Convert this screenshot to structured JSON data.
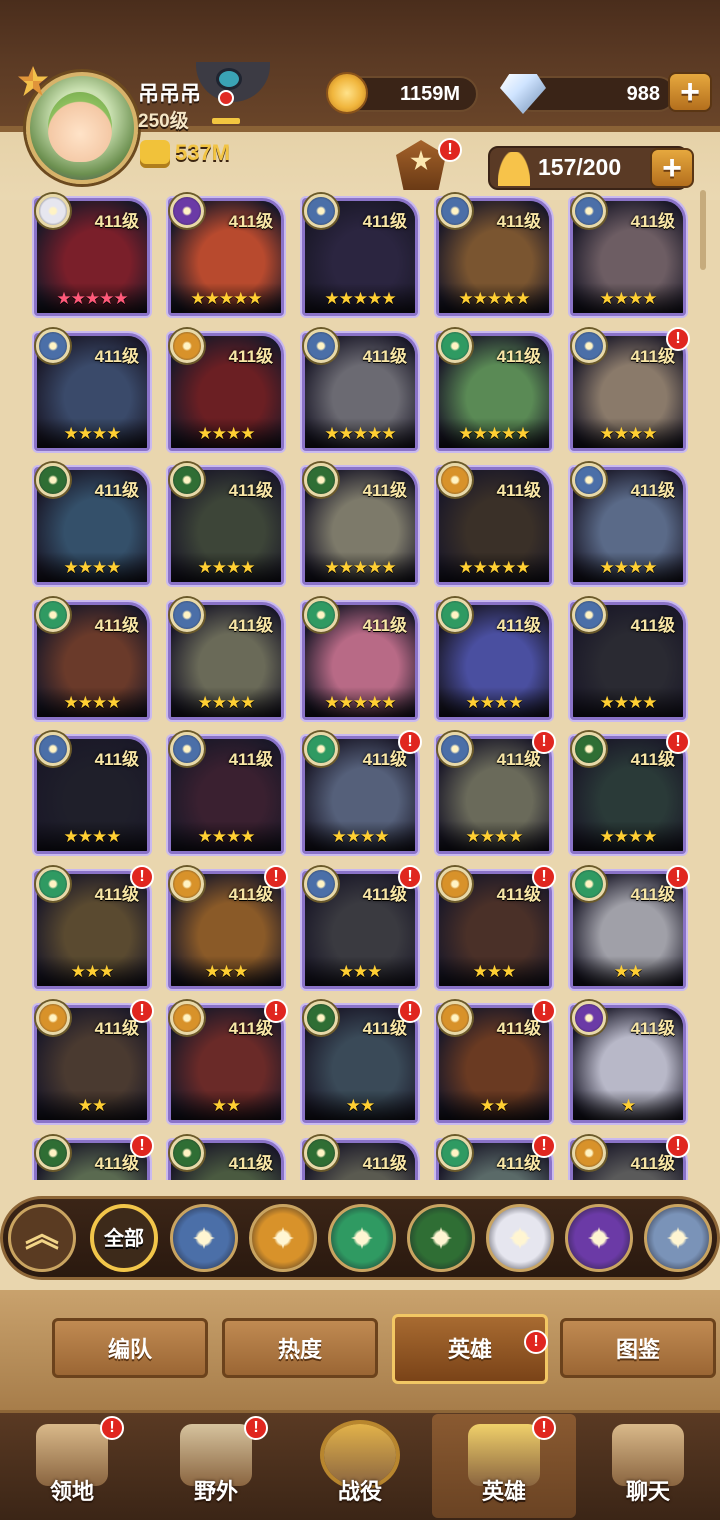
{
  "player": {
    "name": "吊吊吊",
    "level": "250级",
    "power": "537M"
  },
  "resources": {
    "gold": "1159M",
    "gems": "988",
    "roster": "157/200"
  },
  "heroes": [
    {
      "level": "411级",
      "stars": "★★★★★",
      "star_color": "#ff5a7a",
      "faction": "celestial",
      "art": "#7a1f2a"
    },
    {
      "level": "411级",
      "stars": "★★★★★",
      "star_color": "#ffcf33",
      "faction": "hypogean",
      "art": "#b84a2e"
    },
    {
      "level": "411级",
      "stars": "★★★★★",
      "star_color": "#ffcf33",
      "faction": "lightbearer",
      "art": "#2b2540"
    },
    {
      "level": "411级",
      "stars": "★★★★★",
      "star_color": "#ffcf33",
      "faction": "lightbearer",
      "art": "#7a5530"
    },
    {
      "level": "411级",
      "stars": "★★★★",
      "star_color": "#ffcf33",
      "faction": "lightbearer",
      "art": "#6d5d63"
    },
    {
      "level": "411级",
      "stars": "★★★★",
      "star_color": "#ffcf33",
      "faction": "lightbearer",
      "art": "#3a4a6a"
    },
    {
      "level": "411级",
      "stars": "★★★★",
      "star_color": "#ffcf33",
      "faction": "mauler",
      "art": "#6b1f23"
    },
    {
      "level": "411级",
      "stars": "★★★★★",
      "star_color": "#ffcf33",
      "faction": "lightbearer",
      "art": "#6b6a72"
    },
    {
      "level": "411级",
      "stars": "★★★★★",
      "star_color": "#ffcf33",
      "faction": "wilder",
      "art": "#5a8a55"
    },
    {
      "level": "411级",
      "stars": "★★★★",
      "star_color": "#ffcf33",
      "faction": "lightbearer",
      "art": "#8a7a6a",
      "alert": true
    },
    {
      "level": "411级",
      "stars": "★★★★",
      "star_color": "#ffcf33",
      "faction": "graveborn",
      "art": "#34506a"
    },
    {
      "level": "411级",
      "stars": "★★★★",
      "star_color": "#ffcf33",
      "faction": "graveborn",
      "art": "#3d4538"
    },
    {
      "level": "411级",
      "stars": "★★★★★",
      "star_color": "#ffcf33",
      "faction": "graveborn",
      "art": "#7d7a6a"
    },
    {
      "level": "411级",
      "stars": "★★★★★",
      "star_color": "#ffcf33",
      "faction": "mauler",
      "art": "#3a3028"
    },
    {
      "level": "411级",
      "stars": "★★★★",
      "star_color": "#ffcf33",
      "faction": "lightbearer",
      "art": "#5a6a88"
    },
    {
      "level": "411级",
      "stars": "★★★★",
      "star_color": "#ffcf33",
      "faction": "wilder",
      "art": "#6a3a2a"
    },
    {
      "level": "411级",
      "stars": "★★★★",
      "star_color": "#ffcf33",
      "faction": "lightbearer",
      "art": "#6a6a58"
    },
    {
      "level": "411级",
      "stars": "★★★★★",
      "star_color": "#ffcf33",
      "faction": "wilder",
      "art": "#b86a86"
    },
    {
      "level": "411级",
      "stars": "★★★★",
      "star_color": "#ffcf33",
      "faction": "wilder",
      "art": "#4a4fa0"
    },
    {
      "level": "411级",
      "stars": "★★★★",
      "star_color": "#ffcf33",
      "faction": "lightbearer",
      "art": "#2a2a32"
    },
    {
      "level": "411级",
      "stars": "★★★★",
      "star_color": "#ffcf33",
      "faction": "lightbearer",
      "art": "#1f1f2a"
    },
    {
      "level": "411级",
      "stars": "★★★★",
      "star_color": "#ffcf33",
      "faction": "lightbearer",
      "art": "#3a2030"
    },
    {
      "level": "411级",
      "stars": "★★★★",
      "star_color": "#ffcf33",
      "faction": "wilder",
      "art": "#55607a",
      "alert": true
    },
    {
      "level": "411级",
      "stars": "★★★★",
      "star_color": "#ffcf33",
      "faction": "lightbearer",
      "art": "#6a6a5a",
      "alert": true
    },
    {
      "level": "411级",
      "stars": "★★★★",
      "star_color": "#ffcf33",
      "faction": "graveborn",
      "art": "#2a3a38",
      "alert": true
    },
    {
      "level": "411级",
      "stars": "★★★",
      "star_color": "#ffcf33",
      "faction": "wilder",
      "art": "#5a4a30",
      "alert": true
    },
    {
      "level": "411级",
      "stars": "★★★",
      "star_color": "#ffcf33",
      "faction": "mauler",
      "art": "#8a5a28",
      "alert": true
    },
    {
      "level": "411级",
      "stars": "★★★",
      "star_color": "#ffcf33",
      "faction": "lightbearer",
      "art": "#3a3a40",
      "alert": true
    },
    {
      "level": "411级",
      "stars": "★★★",
      "star_color": "#ffcf33",
      "faction": "mauler",
      "art": "#4a3028",
      "alert": true
    },
    {
      "level": "411级",
      "stars": "★★",
      "star_color": "#ffcf33",
      "faction": "wilder",
      "art": "#a0a0a8",
      "alert": true
    },
    {
      "level": "411级",
      "stars": "★★",
      "star_color": "#ffcf33",
      "faction": "mauler",
      "art": "#4a3a30",
      "alert": true
    },
    {
      "level": "411级",
      "stars": "★★",
      "star_color": "#ffcf33",
      "faction": "mauler",
      "art": "#6a2a28",
      "alert": true
    },
    {
      "level": "411级",
      "stars": "★★",
      "star_color": "#ffcf33",
      "faction": "graveborn",
      "art": "#3a4a58",
      "alert": true
    },
    {
      "level": "411级",
      "stars": "★★",
      "star_color": "#ffcf33",
      "faction": "mauler",
      "art": "#6a3a22",
      "alert": true
    },
    {
      "level": "411级",
      "stars": "★",
      "star_color": "#ffcf33",
      "faction": "hypogean",
      "art": "#b8b8c8"
    },
    {
      "level": "411级",
      "stars": "",
      "star_color": "#ffcf33",
      "faction": "graveborn",
      "art": "#5a6a50",
      "alert": true
    },
    {
      "level": "411级",
      "stars": "",
      "star_color": "#ffcf33",
      "faction": "graveborn",
      "art": "#4a5a40"
    },
    {
      "level": "411级",
      "stars": "",
      "star_color": "#ffcf33",
      "faction": "graveborn",
      "art": "#5a5a50"
    },
    {
      "level": "411级",
      "stars": "",
      "star_color": "#ffcf33",
      "faction": "wilder",
      "art": "#5a6a68",
      "alert": true
    },
    {
      "level": "411级",
      "stars": "",
      "star_color": "#ffcf33",
      "faction": "mauler",
      "art": "#5a5a5a",
      "alert": true
    }
  ],
  "faction_colors": {
    "lightbearer": "#4b6fa8",
    "mauler": "#d8922a",
    "wilder": "#2f9a62",
    "graveborn": "#2f6e34",
    "celestial": "#e6e6ef",
    "hypogean": "#6b3aa6",
    "dimensional": "#7a93b8"
  },
  "filters": {
    "collapse_icon": "double-chevron-up",
    "all_label": "全部",
    "factions": [
      "lightbearer",
      "mauler",
      "wilder",
      "graveborn",
      "celestial",
      "hypogean",
      "dimensional"
    ]
  },
  "tabs": [
    {
      "label": "编队"
    },
    {
      "label": "热度"
    },
    {
      "label": "英雄",
      "active": true
    },
    {
      "label": "图鉴"
    }
  ],
  "nav": [
    {
      "label": "领地",
      "icon": "castle-icon",
      "alert": true
    },
    {
      "label": "野外",
      "icon": "scroll-map-icon",
      "alert": true
    },
    {
      "label": "战役",
      "icon": "sword-shield-icon"
    },
    {
      "label": "英雄",
      "icon": "helmet-icon",
      "alert": true,
      "active": true
    },
    {
      "label": "聊天",
      "icon": "chat-bubble-icon"
    }
  ]
}
